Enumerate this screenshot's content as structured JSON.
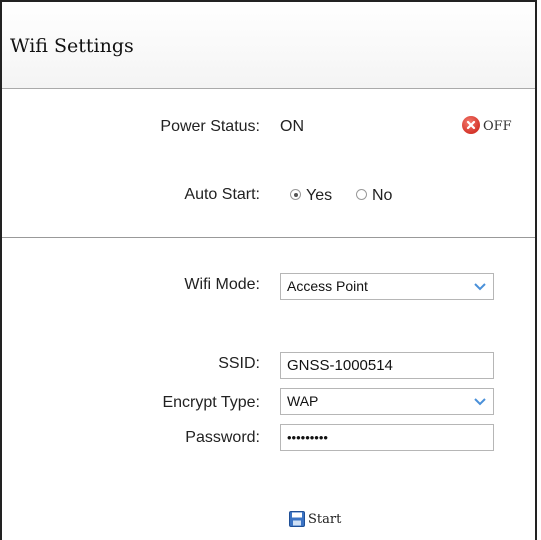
{
  "header": {
    "title": "Wifi Settings"
  },
  "power": {
    "label": "Power Status:",
    "value": "ON",
    "toggle_label": "OFF"
  },
  "autostart": {
    "label": "Auto Start:",
    "options": [
      {
        "label": "Yes",
        "checked": true
      },
      {
        "label": "No",
        "checked": false
      }
    ]
  },
  "wifi": {
    "mode_label": "Wifi Mode:",
    "mode_value": "Access Point",
    "ssid_label": "SSID:",
    "ssid_value": "GNSS-1000514",
    "encrypt_label": "Encrypt Type:",
    "encrypt_value": "WAP",
    "password_label": "Password:",
    "password_value": "•••••••••"
  },
  "actions": {
    "start_label": "Start"
  },
  "icons": {
    "off": "close-circle-icon",
    "start": "save-icon",
    "dropdown": "chevron-down-icon"
  },
  "colors": {
    "off_icon": "#d4352a",
    "save_icon": "#3b73c4"
  }
}
